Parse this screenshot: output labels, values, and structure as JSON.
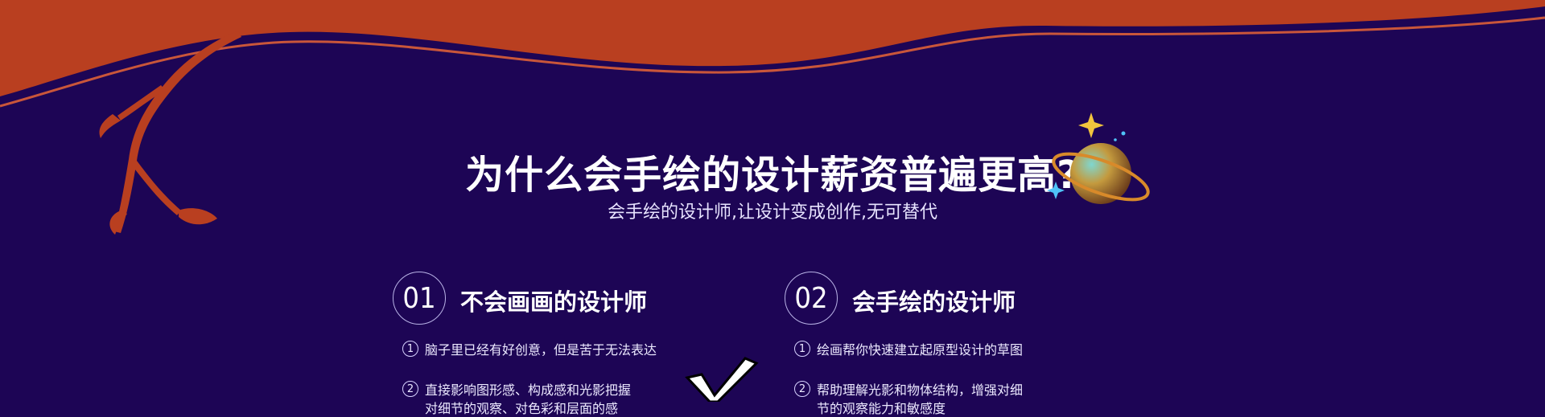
{
  "header": {
    "title": "为什么会手绘的设计薪资普遍更高?",
    "subtitle": "会手绘的设计师,让设计变成创作,无可替代"
  },
  "cards": [
    {
      "number": "01",
      "title": "不会画画的设计师",
      "items": [
        {
          "bullet": "1",
          "text": "脑子里已经有好创意，但是苦于无法表达"
        },
        {
          "bullet": "2",
          "text": "直接影响图形感、构成感和光影把握",
          "continuation": "对细节的观察、对色彩和层面的感"
        }
      ]
    },
    {
      "number": "02",
      "title": "会手绘的设计师",
      "items": [
        {
          "bullet": "1",
          "text": "绘画帮你快速建立起原型设计的草图"
        },
        {
          "bullet": "2",
          "text": "帮助理解光影和物体结构，增强对细",
          "continuation": "节的观察能力和敏感度"
        }
      ]
    }
  ],
  "colors": {
    "background": "#1d0555",
    "banner_orange": "#b93f20",
    "accent_line": "#c9563a"
  },
  "icons": [
    "branch-decoration",
    "planet-icon",
    "sparkle-star-icon",
    "check-mark-graphic"
  ]
}
